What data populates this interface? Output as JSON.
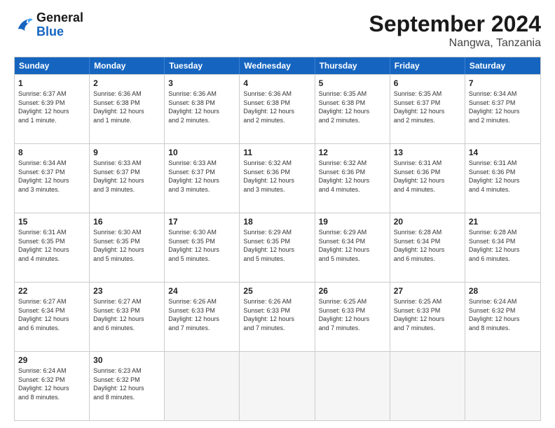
{
  "header": {
    "logo_line1": "General",
    "logo_line2": "Blue",
    "title": "September 2024",
    "subtitle": "Nangwa, Tanzania"
  },
  "days": [
    "Sunday",
    "Monday",
    "Tuesday",
    "Wednesday",
    "Thursday",
    "Friday",
    "Saturday"
  ],
  "weeks": [
    [
      {
        "day": "1",
        "info": "Sunrise: 6:37 AM\nSunset: 6:39 PM\nDaylight: 12 hours\nand 1 minute."
      },
      {
        "day": "2",
        "info": "Sunrise: 6:36 AM\nSunset: 6:38 PM\nDaylight: 12 hours\nand 1 minute."
      },
      {
        "day": "3",
        "info": "Sunrise: 6:36 AM\nSunset: 6:38 PM\nDaylight: 12 hours\nand 2 minutes."
      },
      {
        "day": "4",
        "info": "Sunrise: 6:36 AM\nSunset: 6:38 PM\nDaylight: 12 hours\nand 2 minutes."
      },
      {
        "day": "5",
        "info": "Sunrise: 6:35 AM\nSunset: 6:38 PM\nDaylight: 12 hours\nand 2 minutes."
      },
      {
        "day": "6",
        "info": "Sunrise: 6:35 AM\nSunset: 6:37 PM\nDaylight: 12 hours\nand 2 minutes."
      },
      {
        "day": "7",
        "info": "Sunrise: 6:34 AM\nSunset: 6:37 PM\nDaylight: 12 hours\nand 2 minutes."
      }
    ],
    [
      {
        "day": "8",
        "info": "Sunrise: 6:34 AM\nSunset: 6:37 PM\nDaylight: 12 hours\nand 3 minutes."
      },
      {
        "day": "9",
        "info": "Sunrise: 6:33 AM\nSunset: 6:37 PM\nDaylight: 12 hours\nand 3 minutes."
      },
      {
        "day": "10",
        "info": "Sunrise: 6:33 AM\nSunset: 6:37 PM\nDaylight: 12 hours\nand 3 minutes."
      },
      {
        "day": "11",
        "info": "Sunrise: 6:32 AM\nSunset: 6:36 PM\nDaylight: 12 hours\nand 3 minutes."
      },
      {
        "day": "12",
        "info": "Sunrise: 6:32 AM\nSunset: 6:36 PM\nDaylight: 12 hours\nand 4 minutes."
      },
      {
        "day": "13",
        "info": "Sunrise: 6:31 AM\nSunset: 6:36 PM\nDaylight: 12 hours\nand 4 minutes."
      },
      {
        "day": "14",
        "info": "Sunrise: 6:31 AM\nSunset: 6:36 PM\nDaylight: 12 hours\nand 4 minutes."
      }
    ],
    [
      {
        "day": "15",
        "info": "Sunrise: 6:31 AM\nSunset: 6:35 PM\nDaylight: 12 hours\nand 4 minutes."
      },
      {
        "day": "16",
        "info": "Sunrise: 6:30 AM\nSunset: 6:35 PM\nDaylight: 12 hours\nand 5 minutes."
      },
      {
        "day": "17",
        "info": "Sunrise: 6:30 AM\nSunset: 6:35 PM\nDaylight: 12 hours\nand 5 minutes."
      },
      {
        "day": "18",
        "info": "Sunrise: 6:29 AM\nSunset: 6:35 PM\nDaylight: 12 hours\nand 5 minutes."
      },
      {
        "day": "19",
        "info": "Sunrise: 6:29 AM\nSunset: 6:34 PM\nDaylight: 12 hours\nand 5 minutes."
      },
      {
        "day": "20",
        "info": "Sunrise: 6:28 AM\nSunset: 6:34 PM\nDaylight: 12 hours\nand 6 minutes."
      },
      {
        "day": "21",
        "info": "Sunrise: 6:28 AM\nSunset: 6:34 PM\nDaylight: 12 hours\nand 6 minutes."
      }
    ],
    [
      {
        "day": "22",
        "info": "Sunrise: 6:27 AM\nSunset: 6:34 PM\nDaylight: 12 hours\nand 6 minutes."
      },
      {
        "day": "23",
        "info": "Sunrise: 6:27 AM\nSunset: 6:33 PM\nDaylight: 12 hours\nand 6 minutes."
      },
      {
        "day": "24",
        "info": "Sunrise: 6:26 AM\nSunset: 6:33 PM\nDaylight: 12 hours\nand 7 minutes."
      },
      {
        "day": "25",
        "info": "Sunrise: 6:26 AM\nSunset: 6:33 PM\nDaylight: 12 hours\nand 7 minutes."
      },
      {
        "day": "26",
        "info": "Sunrise: 6:25 AM\nSunset: 6:33 PM\nDaylight: 12 hours\nand 7 minutes."
      },
      {
        "day": "27",
        "info": "Sunrise: 6:25 AM\nSunset: 6:33 PM\nDaylight: 12 hours\nand 7 minutes."
      },
      {
        "day": "28",
        "info": "Sunrise: 6:24 AM\nSunset: 6:32 PM\nDaylight: 12 hours\nand 8 minutes."
      }
    ],
    [
      {
        "day": "29",
        "info": "Sunrise: 6:24 AM\nSunset: 6:32 PM\nDaylight: 12 hours\nand 8 minutes."
      },
      {
        "day": "30",
        "info": "Sunrise: 6:23 AM\nSunset: 6:32 PM\nDaylight: 12 hours\nand 8 minutes."
      },
      {
        "day": "",
        "info": ""
      },
      {
        "day": "",
        "info": ""
      },
      {
        "day": "",
        "info": ""
      },
      {
        "day": "",
        "info": ""
      },
      {
        "day": "",
        "info": ""
      }
    ]
  ]
}
